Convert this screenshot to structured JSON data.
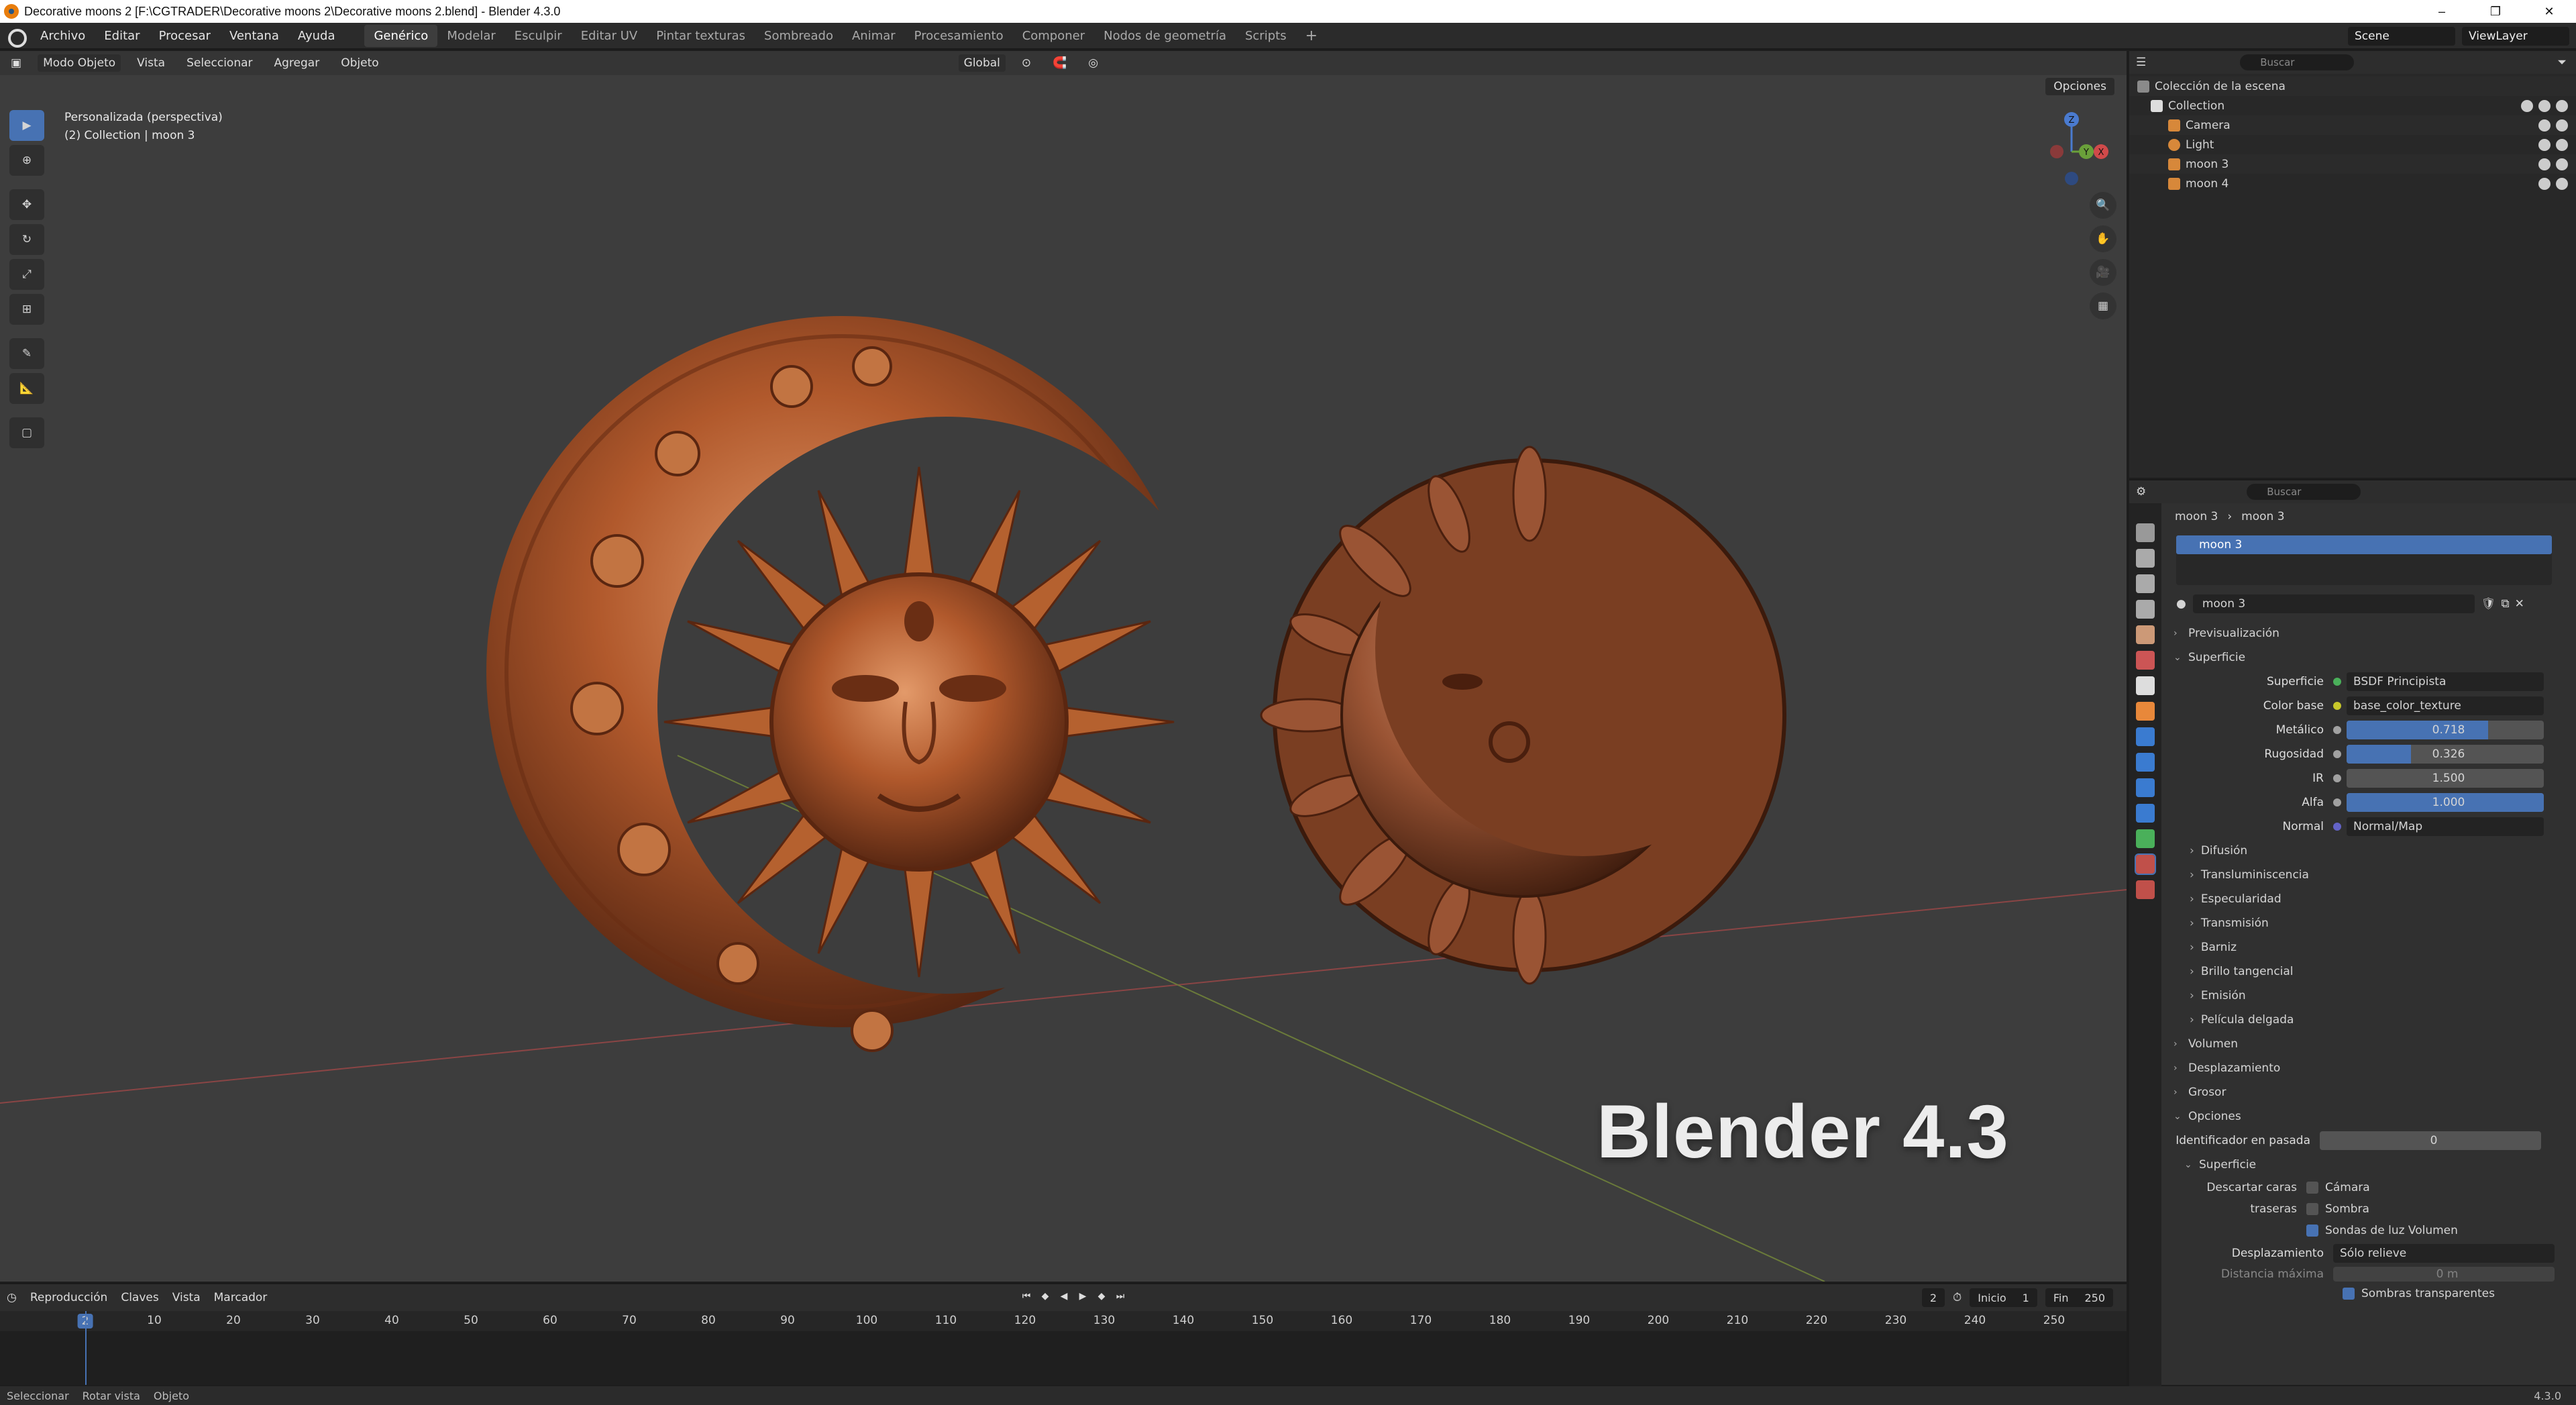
{
  "titlebar": {
    "title": "Decorative moons 2 [F:\\CGTRADER\\Decorative moons 2\\Decorative moons 2.blend] - Blender 4.3.0",
    "minimize": "–",
    "maximize": "❐",
    "close": "✕"
  },
  "menu": {
    "items": [
      "Archivo",
      "Editar",
      "Procesar",
      "Ventana",
      "Ayuda"
    ],
    "workspaces": [
      "Genérico",
      "Modelar",
      "Esculpir",
      "Editar UV",
      "Pintar texturas",
      "Sombreado",
      "Animar",
      "Procesamiento",
      "Componer",
      "Nodos de geometría",
      "Scripts"
    ],
    "active_workspace": "Genérico",
    "add_workspace": "+",
    "scene": "Scene",
    "view_layer": "ViewLayer"
  },
  "viewport": {
    "mode": "Modo Objeto",
    "menus": [
      "Vista",
      "Seleccionar",
      "Agregar",
      "Objeto"
    ],
    "orientation": "Global",
    "options": "Opciones",
    "view_name": "Personalizada (perspectiva)",
    "context": "(2) Collection | moon 3",
    "watermark": "Blender 4.3",
    "gizmo": {
      "z": "Z",
      "y": "Y",
      "x": "X"
    }
  },
  "timeline": {
    "menus": [
      "Reproducción",
      "Claves",
      "Vista",
      "Marcador"
    ],
    "current_frame": "2",
    "start_label": "Inicio",
    "start": "1",
    "end_label": "Fin",
    "end": "250",
    "ticks": [
      "0",
      "10",
      "20",
      "30",
      "40",
      "50",
      "60",
      "70",
      "80",
      "90",
      "100",
      "110",
      "120",
      "130",
      "140",
      "150",
      "160",
      "170",
      "180",
      "190",
      "200",
      "210",
      "220",
      "230",
      "240",
      "250"
    ],
    "frame_badge": "2"
  },
  "statusbar": {
    "select": "Seleccionar",
    "rotate": "Rotar vista",
    "object": "Objeto",
    "version": "4.3.0"
  },
  "outliner": {
    "search_placeholder": "Buscar",
    "root": "Colección de la escena",
    "collection": "Collection",
    "items": [
      {
        "name": "Camera",
        "color": "#d7883a"
      },
      {
        "name": "Light",
        "color": "#d7883a"
      },
      {
        "name": "moon 3",
        "color": "#d7883a"
      },
      {
        "name": "moon 4",
        "color": "#d7883a"
      }
    ]
  },
  "properties": {
    "search_placeholder": "Buscar",
    "breadcrumb_object": "moon 3",
    "breadcrumb_material": "moon 3",
    "slot": "moon 3",
    "material_name": "moon 3",
    "sections_top": [
      "Previsualización",
      "Superficie"
    ],
    "surface_label": "Superficie",
    "surface_value": "BSDF Principista",
    "rows": [
      {
        "label": "Color base",
        "value": "base_color_texture",
        "kind": "link",
        "dot": "#c7c72a"
      },
      {
        "label": "Metálico",
        "value": "0.718",
        "kind": "slider",
        "fill": 0.718,
        "dot": "#a1a1a1"
      },
      {
        "label": "Rugosidad",
        "value": "0.326",
        "kind": "slider",
        "fill": 0.326,
        "dot": "#a1a1a1"
      },
      {
        "label": "IR",
        "value": "1.500",
        "kind": "num",
        "dot": "#a1a1a1"
      },
      {
        "label": "Alfa",
        "value": "1.000",
        "kind": "slider",
        "fill": 1.0,
        "dot": "#a1a1a1"
      },
      {
        "label": "Normal",
        "value": "Normal/Map",
        "kind": "link",
        "dot": "#6363c7"
      }
    ],
    "subsections": [
      "Difusión",
      "Transluminiscencia",
      "Especularidad",
      "Transmisión",
      "Barniz",
      "Brillo tangencial",
      "Emisión",
      "Película delgada"
    ],
    "sections_bottom": [
      "Volumen",
      "Desplazamiento",
      "Grosor",
      "Opciones"
    ],
    "pass_label": "Identificador en pasada",
    "pass_value": "0",
    "surface_sub": "Superficie",
    "backface_label": "Descartar caras traseras",
    "checks": [
      {
        "label": "Cámara",
        "on": false
      },
      {
        "label": "Sombra",
        "on": false
      },
      {
        "label": "Sondas de luz Volumen",
        "on": true
      }
    ],
    "displacement_label": "Desplazamiento",
    "displacement_value": "Sólo relieve",
    "max_distance_label": "Distancia máxima",
    "max_distance_value": "0 m",
    "transparent_shadows": "Sombras transparentes"
  },
  "colors": {
    "accent": "#4772b3",
    "copper": "#b8633a",
    "viewport_bg": "#3d3d3d"
  }
}
